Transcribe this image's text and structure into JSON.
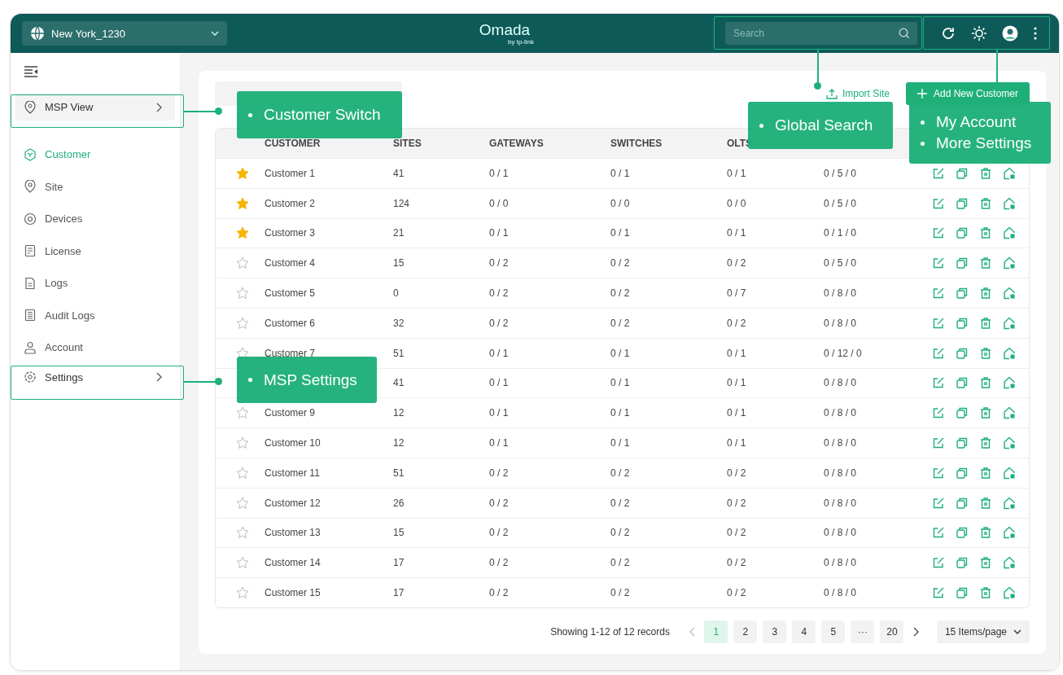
{
  "header": {
    "site_selector": "New York_1230",
    "logo": "Omada",
    "logo_sub": "by tp-link",
    "search": {
      "placeholder": "Search"
    }
  },
  "sidebar": {
    "view_switch": {
      "label": "MSP View",
      "selected": true
    },
    "items": [
      {
        "label": "Customer",
        "selected": true
      },
      {
        "label": "Site",
        "selected": false
      },
      {
        "label": "Devices",
        "selected": false
      },
      {
        "label": "License",
        "selected": false
      },
      {
        "label": "Logs",
        "selected": false
      },
      {
        "label": "Audit Logs",
        "selected": false
      },
      {
        "label": "Account",
        "selected": false
      }
    ],
    "settings": "Settings"
  },
  "toolbar": {
    "import": "Import Site",
    "add": "Add New Customer"
  },
  "table": {
    "columns": [
      "CUSTOMER",
      "SITES",
      "GATEWAYS",
      "SWITCHES",
      "OLTS"
    ],
    "rows": [
      {
        "starred": true,
        "name": "Customer 1",
        "sites": "41",
        "gateways": "0 / 1",
        "switches": "0 / 1",
        "olts": "0 / 1",
        "eaps": "0 / 5 / 0"
      },
      {
        "starred": true,
        "name": "Customer 2",
        "sites": "124",
        "gateways": "0 / 0",
        "switches": "0 / 0",
        "olts": "0 / 0",
        "eaps": "0 / 5 / 0"
      },
      {
        "starred": true,
        "name": "Customer 3",
        "sites": "21",
        "gateways": "0 / 1",
        "switches": "0 / 1",
        "olts": "0 / 1",
        "eaps": "0 / 1 / 0"
      },
      {
        "starred": false,
        "name": "Customer 4",
        "sites": "15",
        "gateways": "0 / 2",
        "switches": "0 / 2",
        "olts": "0 / 2",
        "eaps": "0 / 5 / 0"
      },
      {
        "starred": false,
        "name": "Customer 5",
        "sites": "0",
        "gateways": "0 / 2",
        "switches": "0 / 2",
        "olts": "0 / 7",
        "eaps": "0 / 8 / 0"
      },
      {
        "starred": false,
        "name": "Customer 6",
        "sites": "32",
        "gateways": "0 / 2",
        "switches": "0 / 2",
        "olts": "0 / 2",
        "eaps": "0 / 8 / 0"
      },
      {
        "starred": false,
        "name": "Customer 7",
        "sites": "51",
        "gateways": "0 / 1",
        "switches": "0 / 1",
        "olts": "0 / 1",
        "eaps": "0 / 12 / 0"
      },
      {
        "sites": "41",
        "gateways": "0 / 1",
        "switches": "0 / 1",
        "olts": "0 / 1",
        "eaps": "0 / 8 / 0"
      },
      {
        "starred": false,
        "name": "Customer 9",
        "sites": "12",
        "gateways": "0 / 1",
        "switches": "0 / 1",
        "olts": "0 / 1",
        "eaps": "0 / 8 / 0"
      },
      {
        "starred": false,
        "name": "Customer 10",
        "sites": "12",
        "gateways": "0 / 1",
        "switches": "0 / 1",
        "olts": "0 / 1",
        "eaps": "0 / 8 / 0"
      },
      {
        "starred": false,
        "name": "Customer 11",
        "sites": "51",
        "gateways": "0 / 2",
        "switches": "0 / 2",
        "olts": "0 / 2",
        "eaps": "0 / 8 / 0"
      },
      {
        "starred": false,
        "name": "Customer 12",
        "sites": "26",
        "gateways": "0 / 2",
        "switches": "0 / 2",
        "olts": "0 / 2",
        "eaps": "0 / 8 / 0"
      },
      {
        "starred": false,
        "name": "Customer 13",
        "sites": "15",
        "gateways": "0 / 2",
        "switches": "0 / 2",
        "olts": "0 / 2",
        "eaps": "0 / 8 / 0"
      },
      {
        "starred": false,
        "name": "Customer 14",
        "sites": "17",
        "gateways": "0 / 2",
        "switches": "0 / 2",
        "olts": "0 / 2",
        "eaps": "0 / 8 / 0"
      },
      {
        "starred": false,
        "name": "Customer 15",
        "sites": "17",
        "gateways": "0 / 2",
        "switches": "0 / 2",
        "olts": "0 / 2",
        "eaps": "0 / 8 / 0"
      }
    ]
  },
  "pagination": {
    "summary": "Showing 1-12 of 12 records",
    "pages": [
      {
        "label": "1",
        "selected": true
      },
      {
        "label": "2",
        "selected": false
      },
      {
        "label": "3",
        "selected": false
      },
      {
        "label": "4",
        "selected": false
      },
      {
        "label": "5",
        "selected": false
      },
      {
        "label": "···",
        "selected": false
      },
      {
        "label": "20",
        "selected": false
      }
    ],
    "page_size": "15 Items/page"
  },
  "callouts": [
    {
      "items": [
        "Customer Switch"
      ]
    },
    {
      "items": [
        "Global Search"
      ]
    },
    {
      "items": [
        "My Account",
        "More Settings"
      ]
    },
    {
      "items": [
        "MSP Settings"
      ]
    }
  ]
}
